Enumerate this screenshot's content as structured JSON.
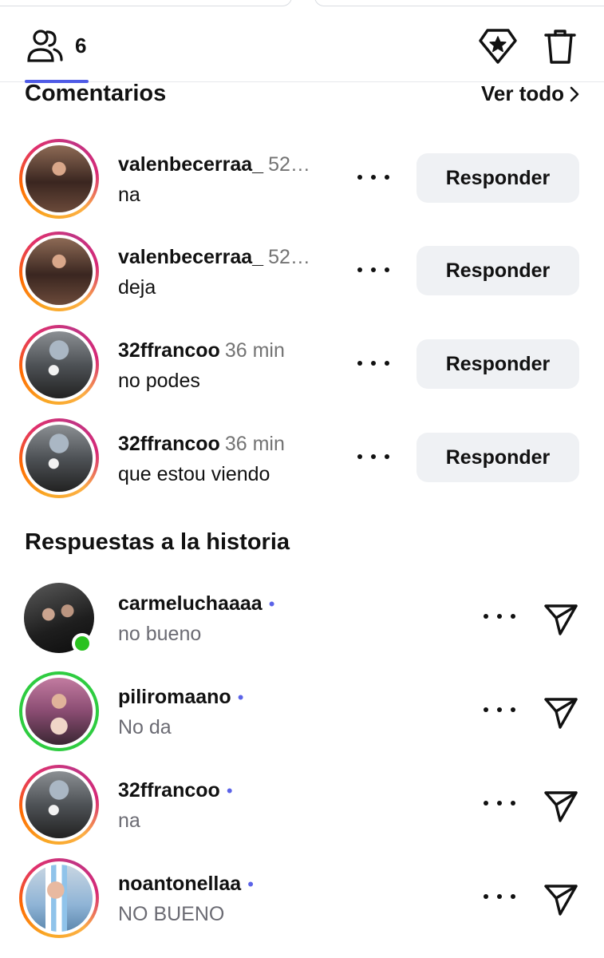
{
  "header": {
    "viewer_count": "6",
    "icons": {
      "viewers": "people-icon",
      "highlight": "gem-star-icon",
      "delete": "trash-icon"
    },
    "accent_color": "#4f5be6"
  },
  "comments_section": {
    "title": "Comentarios",
    "see_all": "Ver todo",
    "items": [
      {
        "username": "valenbecerraa_",
        "time": "52…",
        "message": "na",
        "reply_label": "Responder"
      },
      {
        "username": "valenbecerraa_",
        "time": "52…",
        "message": "deja",
        "reply_label": "Responder"
      },
      {
        "username": "32ffrancoo",
        "time": "36 min",
        "message": "no podes",
        "reply_label": "Responder"
      },
      {
        "username": "32ffrancoo",
        "time": "36 min",
        "message": "que estou viendo",
        "reply_label": "Responder"
      }
    ]
  },
  "replies_section": {
    "title": "Respuestas a la historia",
    "items": [
      {
        "username": "carmeluchaaaa",
        "message": "no bueno",
        "unread_dot": "•"
      },
      {
        "username": "piliromaano",
        "message": "No da",
        "unread_dot": "•"
      },
      {
        "username": "32ffrancoo",
        "message": "na",
        "unread_dot": "•"
      },
      {
        "username": "noantonellaa",
        "message": "NO BUENO",
        "unread_dot": "•"
      }
    ]
  }
}
